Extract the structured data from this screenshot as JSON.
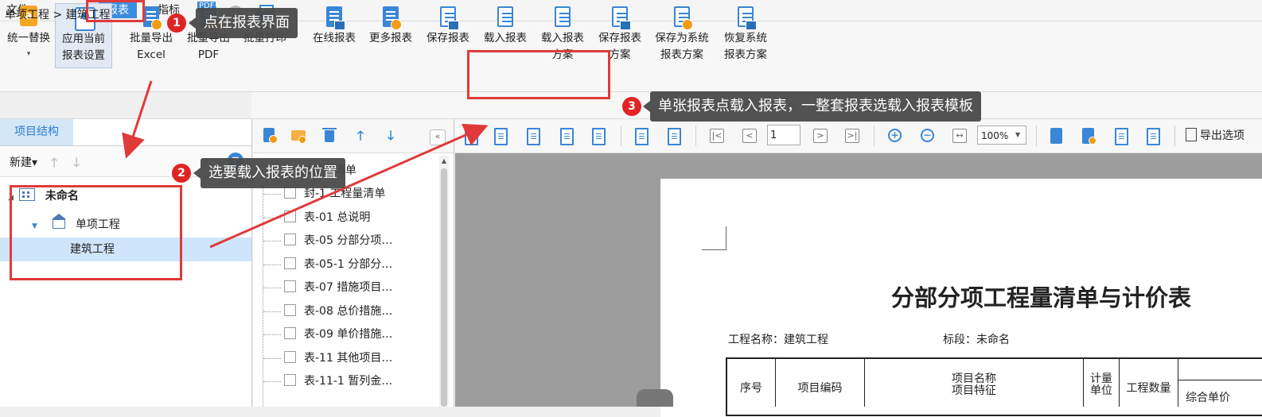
{
  "menu": {
    "items": [
      {
        "label": "文件▾"
      },
      {
        "label": "编制"
      },
      {
        "label": "报表"
      },
      {
        "label": "指标"
      }
    ]
  },
  "ribbon": {
    "unify_replace": {
      "line1": "统一替换",
      "caret": "▾"
    },
    "apply_current": {
      "line1": "应用当前",
      "line2": "报表设置"
    },
    "batch_excel": {
      "line1": "批量导出",
      "line2": "Excel"
    },
    "batch_pdf": {
      "line1": "批量导出",
      "line2": "PDF",
      "tag": "PDF"
    },
    "batch_print": {
      "line1": "批量打印"
    },
    "online_report": {
      "line1": "在线报表"
    },
    "more_reports": {
      "line1": "更多报表"
    },
    "save_report": {
      "line1": "保存报表"
    },
    "load_report": {
      "line1": "载入报表"
    },
    "load_scheme": {
      "line1": "载入报表",
      "line2": "方案"
    },
    "save_scheme": {
      "line1": "保存报表",
      "line2": "方案"
    },
    "save_system_scheme": {
      "line1": "保存为系统",
      "line2": "报表方案"
    },
    "restore_system_scheme": {
      "line1": "恢复系统",
      "line2": "报表方案"
    }
  },
  "breadcrumb": {
    "text": "单项工程 > 建筑工程",
    "collapse_glyph": "︽"
  },
  "left_panel": {
    "tab": "项目结构",
    "new_label": "新建▾",
    "tree": {
      "root": "未命名",
      "single": "单项工程",
      "building": "建筑工程"
    }
  },
  "reports": {
    "parent": "工程量清单",
    "items": [
      "封-1 工程量清单",
      "表-01 总说明",
      "表-05 分部分项…",
      "表-05-1 分部分…",
      "表-07 措施项目…",
      "表-08 总价措施…",
      "表-09 单价措施…",
      "表-11 其他项目…",
      "表-11-1 暂列金…"
    ],
    "collapse_glyph": "«"
  },
  "preview_toolbar": {
    "page_value": "1",
    "zoom_value": "100%",
    "export_option": "导出选项"
  },
  "preview": {
    "title": "分部分项工程量清单与计价表",
    "project_name": "工程名称：建筑工程",
    "section_name": "标段：未命名",
    "headers": {
      "seq": "序号",
      "code": "项目编码",
      "name1": "项目名称",
      "name2": "项目特征",
      "unit1": "计量",
      "unit2": "单位",
      "qty": "工程数量",
      "unit_price": "综合单价"
    }
  },
  "annotations": {
    "step1": {
      "num": "1",
      "text": "点在报表界面"
    },
    "step2": {
      "num": "2",
      "text": "选要载入报表的位置"
    },
    "step3": {
      "num": "3",
      "text": "单张报表点载入报表，一整套报表选载入报表模板"
    }
  },
  "colors": {
    "accent": "#3a86d6",
    "annotation_red": "#e03a3a",
    "selected_row": "#cfe5fb",
    "canvas_gray": "#9d9d9d"
  }
}
